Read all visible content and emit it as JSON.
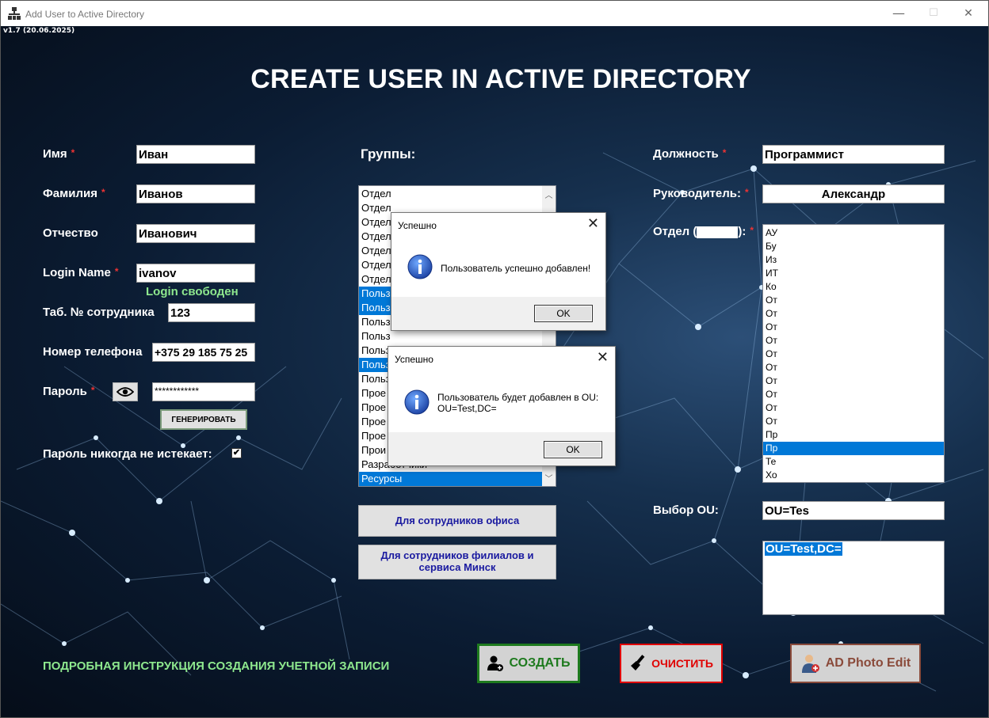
{
  "window": {
    "title": "Add User to Active Directory",
    "minimize": "—",
    "maximize": "☐",
    "close": "✕"
  },
  "version": "v1.7 (20.06.2025)",
  "main_title": "CREATE USER IN ACTIVE DIRECTORY",
  "form": {
    "first_name": {
      "label": "Имя",
      "value": "Иван",
      "required": "*"
    },
    "last_name": {
      "label": "Фамилия",
      "value": "Иванов",
      "required": "*"
    },
    "middle_name": {
      "label": "Отчество",
      "value": "Иванович"
    },
    "login": {
      "label": "Login Name",
      "value": "ivanov",
      "required": "*",
      "status": "Login свободен"
    },
    "employee_id": {
      "label": "Таб. № сотрудника",
      "value": "123"
    },
    "phone": {
      "label": "Номер телефона",
      "value": "+375 29 185 75 25"
    },
    "password": {
      "label": "Пароль",
      "value": "************",
      "required": "*",
      "generate": "ГЕНЕРИРОВАТЬ"
    },
    "never_expires": {
      "label": "Пароль никогда не истекает:",
      "checked": "✔"
    }
  },
  "groups": {
    "label": "Группы:",
    "items": [
      {
        "text": "Отдел",
        "selected": false
      },
      {
        "text": "Отдел",
        "selected": false
      },
      {
        "text": "Отдел",
        "selected": false
      },
      {
        "text": "Отдел",
        "selected": false
      },
      {
        "text": "Отдел",
        "selected": false
      },
      {
        "text": "Отдел",
        "selected": false
      },
      {
        "text": "Отдел",
        "selected": false
      },
      {
        "text": "Польз",
        "selected": true
      },
      {
        "text": "Польз",
        "selected": true
      },
      {
        "text": "Польз",
        "selected": false
      },
      {
        "text": "Польз",
        "selected": false
      },
      {
        "text": "Польз",
        "selected": false
      },
      {
        "text": "Польз",
        "selected": true
      },
      {
        "text": "Польз",
        "selected": false
      },
      {
        "text": "Прое",
        "selected": false
      },
      {
        "text": "Прое",
        "selected": false
      },
      {
        "text": "Прое",
        "selected": false
      },
      {
        "text": "Прое",
        "selected": false
      },
      {
        "text": "Прои",
        "selected": false
      },
      {
        "text": "Разработчики",
        "selected": false
      },
      {
        "text": "Ресурсы",
        "selected": true
      }
    ],
    "office_button": "Для сотрудников офиса",
    "branch_button": "Для сотрудников филиалов и сервиса Минск"
  },
  "right": {
    "position": {
      "label": "Должность",
      "value": "Программист",
      "required": "*"
    },
    "manager": {
      "label": "Руководитель:",
      "value": "Александр",
      "required": "*"
    },
    "department": {
      "label_prefix": "Отдел (",
      "label_suffix": "):",
      "required": "*",
      "items": [
        {
          "text": "АУ",
          "selected": false
        },
        {
          "text": "Бу",
          "selected": false
        },
        {
          "text": "Из",
          "selected": false
        },
        {
          "text": "ИТ",
          "selected": false
        },
        {
          "text": "Ко",
          "selected": false
        },
        {
          "text": "От",
          "selected": false
        },
        {
          "text": "От",
          "selected": false
        },
        {
          "text": "От",
          "selected": false
        },
        {
          "text": "От",
          "selected": false
        },
        {
          "text": "От",
          "selected": false
        },
        {
          "text": "От",
          "selected": false
        },
        {
          "text": "От",
          "selected": false
        },
        {
          "text": "От",
          "selected": false
        },
        {
          "text": "От",
          "selected": false
        },
        {
          "text": "От",
          "selected": false
        },
        {
          "text": "Пр",
          "selected": false
        },
        {
          "text": "Пр",
          "selected": true
        },
        {
          "text": "Те",
          "selected": false
        },
        {
          "text": "Хо",
          "selected": false
        }
      ]
    },
    "ou": {
      "label": "Выбор OU:",
      "value": "OU=Tes",
      "result": "OU=Test,DC="
    }
  },
  "dialogs": [
    {
      "title": "Успешно",
      "message": "Пользователь успешно добавлен!",
      "ok": "OK"
    },
    {
      "title": "Успешно",
      "message_line1": "Пользователь будет добавлен в OU:",
      "message_line2": "OU=Test,DC=",
      "ok": "OK"
    }
  ],
  "instructions": "ПОДРОБНАЯ ИНСТРУКЦИЯ СОЗДАНИЯ УЧЕТНОЙ ЗАПИСИ",
  "buttons": {
    "create": {
      "label": "СОЗДАТЬ",
      "color": "#1e7a1e"
    },
    "clear": {
      "label": "ОЧИСТИТЬ",
      "color": "#e00000"
    },
    "photo": {
      "label": "AD Photo Edit",
      "color": "#8a4a3a"
    }
  }
}
